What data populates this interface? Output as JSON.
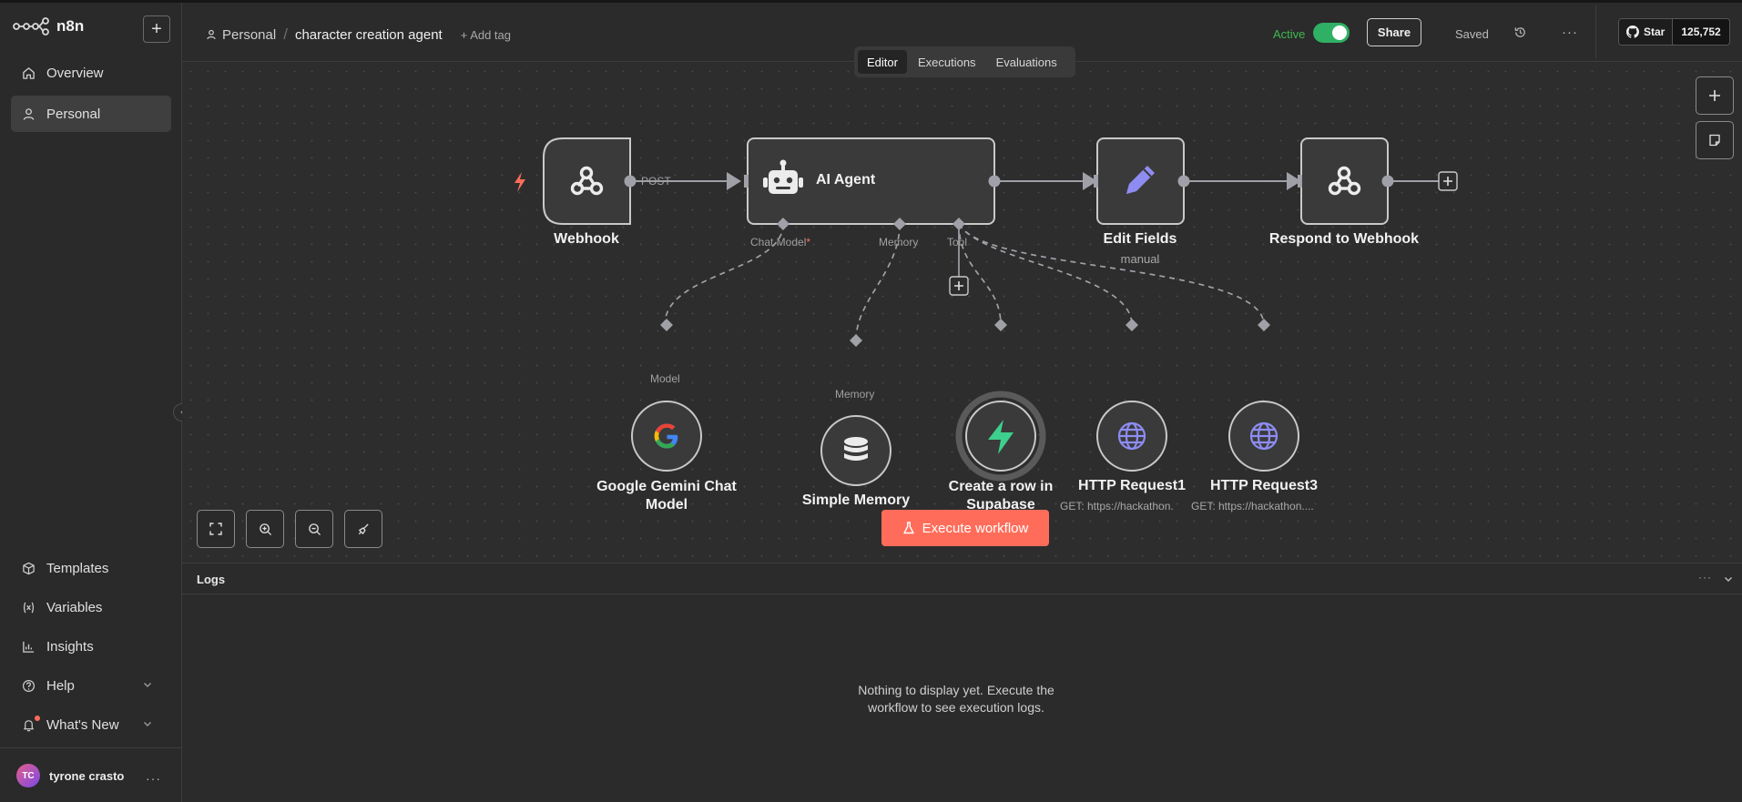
{
  "app": {
    "name": "n8n"
  },
  "sidebar": {
    "items": [
      {
        "label": "Overview",
        "icon": "home-icon"
      },
      {
        "label": "Personal",
        "icon": "user-icon"
      }
    ],
    "bottom_items": [
      {
        "label": "Templates",
        "icon": "box-icon"
      },
      {
        "label": "Variables",
        "icon": "variable-icon"
      },
      {
        "label": "Insights",
        "icon": "bar-chart-icon"
      },
      {
        "label": "Help",
        "icon": "help-icon"
      },
      {
        "label": "What's New",
        "icon": "bell-icon"
      }
    ],
    "user": {
      "initials": "TC",
      "name": "tyrone crasto"
    }
  },
  "header": {
    "project": "Personal",
    "separator": "/",
    "workflow_name": "character creation agent",
    "add_tag": "+ Add tag",
    "active_label": "Active",
    "active": true,
    "share_label": "Share",
    "saved_label": "Saved",
    "github": {
      "star_label": "Star",
      "count": "125,752"
    }
  },
  "tabs": [
    {
      "label": "Editor",
      "active": true
    },
    {
      "label": "Executions",
      "active": false
    },
    {
      "label": "Evaluations",
      "active": false
    }
  ],
  "canvas": {
    "nodes": {
      "webhook": {
        "label": "Webhook"
      },
      "ai_agent": {
        "label": "AI Agent"
      },
      "edit_fields": {
        "label": "Edit Fields",
        "sub": "manual"
      },
      "respond": {
        "label": "Respond to Webhook"
      },
      "gemini": {
        "label_line1": "Google Gemini Chat",
        "label_line2": "Model"
      },
      "memory": {
        "label": "Simple Memory"
      },
      "supabase": {
        "label_line1": "Create a row in",
        "label_line2": "Supabase"
      },
      "http1": {
        "label": "HTTP Request1",
        "sub": "GET: https://hackathon."
      },
      "http3": {
        "label": "HTTP Request3",
        "sub": "GET: https://hackathon...."
      }
    },
    "edge_labels": {
      "post": "POST"
    },
    "ports": {
      "chat_model": "Chat Model",
      "required_mark": "*",
      "memory": "Memory",
      "tool": "Tool",
      "model_in": "Model",
      "memory_in": "Memory"
    },
    "execute_label": "Execute workflow"
  },
  "logs": {
    "title": "Logs",
    "empty_line1": "Nothing to display yet. Execute the",
    "empty_line2": "workflow to see execution logs."
  },
  "colors": {
    "accent": "#ff6d5a",
    "active_green": "#2fb064",
    "node_bg": "#3a3a3a",
    "edge": "#a0a0a8"
  }
}
